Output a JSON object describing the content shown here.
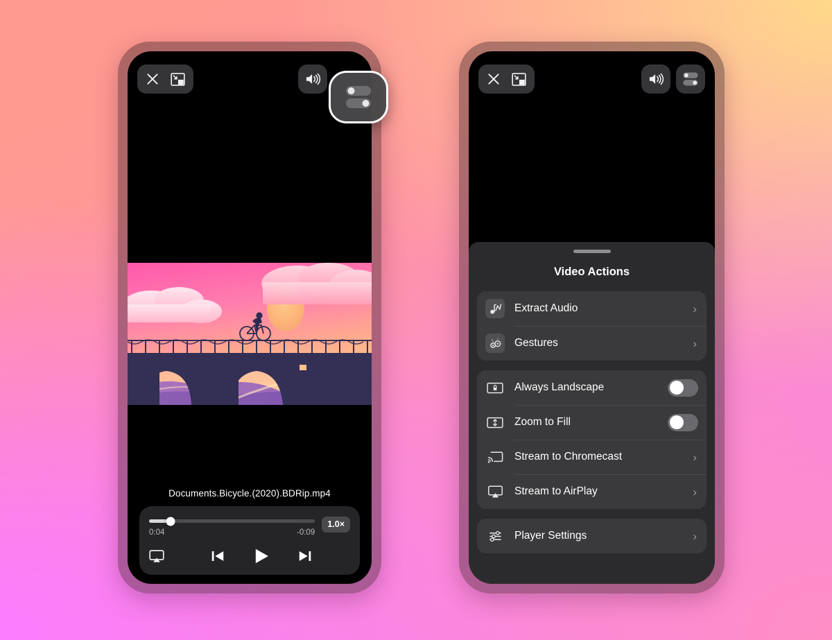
{
  "background": {
    "colors": [
      "#ff9d8d",
      "#ffd98a",
      "#ff8fc4",
      "#fb7cff"
    ]
  },
  "phones": {
    "left": {
      "name": "video-player-screen",
      "topbar": {
        "close_icon": "close-icon",
        "pip_icon": "picture-in-picture-icon",
        "volume_icon": "volume-icon",
        "settings_icon": "sliders-toggle-icon"
      },
      "video": {
        "artwork_alt": "cyclist-on-bridge-at-sunset",
        "filename": "Documents.Bicycle.(2020).BDRip.mp4"
      },
      "controls": {
        "elapsed": "0:04",
        "remaining": "-0:09",
        "speed": "1.0×",
        "progress_percent": 13,
        "airplay_icon": "airplay-icon",
        "previous_icon": "skip-previous-icon",
        "play_icon": "play-icon",
        "next_icon": "skip-next-icon"
      }
    },
    "right": {
      "name": "video-actions-sheet-screen",
      "topbar": {
        "close_icon": "close-icon",
        "pip_icon": "picture-in-picture-icon",
        "volume_icon": "volume-icon",
        "settings_icon": "sliders-toggle-icon"
      },
      "sheet": {
        "title": "Video Actions",
        "groups": [
          {
            "id": "actions-group",
            "rows": [
              {
                "icon": "music-note-icon",
                "label": "Extract Audio",
                "accessory": "chevron"
              },
              {
                "icon": "gestures-icon",
                "label": "Gestures",
                "accessory": "chevron"
              }
            ]
          },
          {
            "id": "display-group",
            "rows": [
              {
                "icon": "landscape-lock-icon",
                "label": "Always Landscape",
                "accessory": "toggle",
                "value": false
              },
              {
                "icon": "zoom-fill-icon",
                "label": "Zoom to Fill",
                "accessory": "toggle",
                "value": false
              },
              {
                "icon": "chromecast-icon",
                "label": "Stream to Chromecast",
                "accessory": "chevron"
              },
              {
                "icon": "airplay-icon",
                "label": "Stream to AirPlay",
                "accessory": "chevron"
              }
            ]
          },
          {
            "id": "settings-group",
            "rows": [
              {
                "icon": "equalizer-icon",
                "label": "Player Settings",
                "accessory": "chevron"
              }
            ]
          }
        ]
      }
    }
  },
  "glyphs": {
    "chevron": "›"
  }
}
